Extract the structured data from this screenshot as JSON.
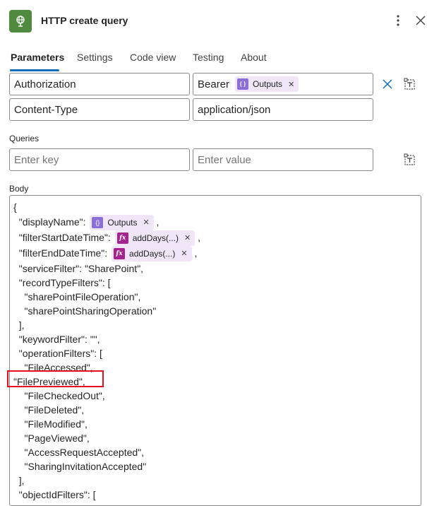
{
  "header": {
    "title": "HTTP create query",
    "more_icon": "more-vertical-icon",
    "close_icon": "close-icon",
    "app_icon": "globe-icon",
    "app_color": "#4f8a3e"
  },
  "tabs": [
    {
      "label": "Parameters",
      "active": true
    },
    {
      "label": "Settings"
    },
    {
      "label": "Code view"
    },
    {
      "label": "Testing"
    },
    {
      "label": "About"
    }
  ],
  "headers_rows": [
    {
      "key": "Authorization",
      "value_text": "Bearer",
      "value_token": "Outputs"
    },
    {
      "key": "Content-Type",
      "value": "application/json"
    }
  ],
  "queries": {
    "label": "Queries",
    "key_placeholder": "Enter key",
    "value_placeholder": "Enter value"
  },
  "body": {
    "label": "Body",
    "lines": [
      {
        "text": "{"
      },
      {
        "text": "  \"displayName\": ",
        "token": {
          "label": "Outputs",
          "kind": "var"
        },
        "after": ","
      },
      {
        "text": "  \"filterStartDateTime\": ",
        "token": {
          "label": "addDays(...)",
          "kind": "fx"
        },
        "after": ","
      },
      {
        "text": "  \"filterEndDateTime\": ",
        "token": {
          "label": "addDays(...)",
          "kind": "fx"
        },
        "after": ","
      },
      {
        "text": "  \"serviceFilter\": \"SharePoint\","
      },
      {
        "text": "  \"recordTypeFilters\": ["
      },
      {
        "text": "    \"sharePointFileOperation\","
      },
      {
        "text": "    \"sharePointSharingOperation\""
      },
      {
        "text": "  ],"
      },
      {
        "text": "  \"keywordFilter\": \"\","
      },
      {
        "text": "  \"operationFilters\": ["
      },
      {
        "text": "    \"FileAccessed\","
      },
      {
        "text": "\"FilePreviewed\","
      },
      {
        "text": "    \"FileCheckedOut\","
      },
      {
        "text": "    \"FileDeleted\","
      },
      {
        "text": "    \"FileModified\","
      },
      {
        "text": "    \"PageViewed\","
      },
      {
        "text": "    \"AccessRequestAccepted\","
      },
      {
        "text": "    \"SharingInvitationAccepted\""
      },
      {
        "text": "  ],"
      },
      {
        "text": "  \"objectIdFilters\": ["
      }
    ]
  },
  "colors": {
    "accent": "#0f6cbd",
    "highlight_box": "#e8101f",
    "token_bg": "#f0e6f7",
    "fx_icon": "#a4238f",
    "var_icon": "#8b6fd6"
  }
}
